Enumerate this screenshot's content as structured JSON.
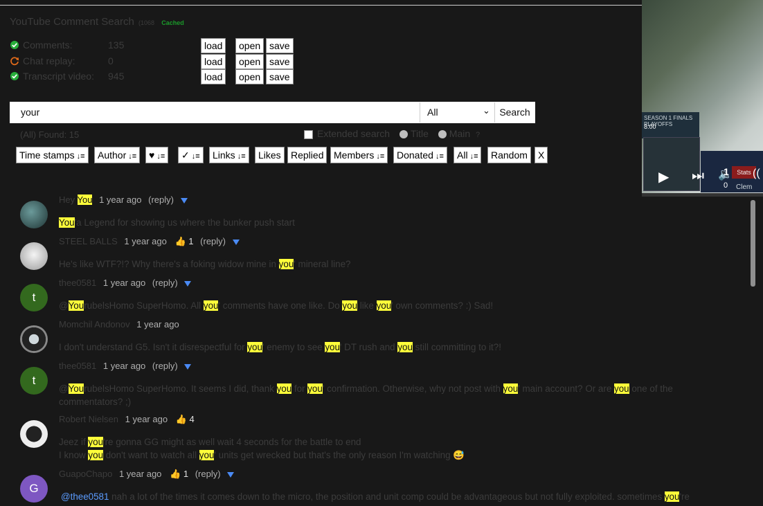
{
  "header": {
    "title": "YouTube Comment Search",
    "version": "(1068",
    "cached": "Cached"
  },
  "sources": [
    {
      "label": "Comments:",
      "count": "135",
      "status": "done"
    },
    {
      "label": "Chat replay:",
      "count": "0",
      "status": "pending"
    },
    {
      "label": "Transcript video:",
      "count": "945",
      "status": "done"
    }
  ],
  "buttons": {
    "load": "load",
    "open": "open",
    "save": "save"
  },
  "search": {
    "query": "your",
    "scope": "All",
    "button": "Search"
  },
  "found_label": "(All) Found: 15",
  "options": {
    "extended": "Extended search",
    "title": "Title",
    "main": "Main",
    "help": "?"
  },
  "sort_buttons": [
    "Time stamps",
    "Author",
    "♥",
    "✓",
    "Links",
    "Likes",
    "Replied",
    "Members",
    "Donated",
    "All",
    "Random",
    "X"
  ],
  "video": {
    "season": "SEASON 1 FINALS PLAYOFFS",
    "time": "8:00",
    "stats": "Stats",
    "player": "Clem",
    "big_number": "1",
    "small_number": "0"
  },
  "colors": {
    "highlight": "#ffff3a",
    "reply_toggle": "#4a8af4",
    "mention": "#5b9cff",
    "ok_green": "#27ae3a",
    "pending_orange": "#e06a1a"
  },
  "comments": [
    {
      "author": "Hey ",
      "author_hl": "You",
      "date": "1 year ago",
      "reply": "(reply)",
      "likes": "",
      "avatar": {
        "type": "image",
        "color": "#3a5a5a"
      },
      "lines": [
        [
          "",
          "You",
          "'a Legend for showing us where the bunker push start"
        ]
      ]
    },
    {
      "author": "STEEL BALLS",
      "date": "1 year ago",
      "likes": "1",
      "reply": "(reply)",
      "avatar": {
        "type": "image",
        "color": "#d9d9d9"
      },
      "lines": [
        [
          "He's like WTF?!? Why there's a foking widow mine in ",
          "you",
          "' mineral line?"
        ]
      ]
    },
    {
      "author": "thee0581",
      "date": "1 year ago",
      "reply": "(reply)",
      "likes": "",
      "avatar": {
        "type": "letter",
        "letter": "t",
        "color": "#33691e"
      },
      "lines": [
        [
          "@",
          "You",
          "rubelsHomo SuperHomo. All ",
          "you",
          "' comments have one like. Do ",
          "you",
          " like ",
          "you",
          "' own comments? :) Sad!"
        ]
      ]
    },
    {
      "author": "Momchil Andonov",
      "date": "1 year ago",
      "reply": "",
      "likes": "",
      "avatar": {
        "type": "image",
        "color": "#444"
      },
      "lines": [
        [
          "I don't understand G5. Isn't it disrespectful for ",
          "you",
          "' enemy to see ",
          "you",
          "' DT rush and ",
          "you",
          " still committing to it?!"
        ]
      ]
    },
    {
      "author": "thee0581",
      "date": "1 year ago",
      "reply": "(reply)",
      "likes": "",
      "avatar": {
        "type": "letter",
        "letter": "t",
        "color": "#33691e"
      },
      "lines": [
        [
          "@",
          "You",
          "rubelsHomo SuperHomo. It seems I did, thank ",
          "you",
          " for ",
          "you",
          "' confirmation. Otherwise, why not post with ",
          "you",
          "' main account? Or are ",
          "you",
          " one of the"
        ],
        [
          "commentators? ;)"
        ]
      ]
    },
    {
      "author": "Robert Nielsen",
      "date": "1 year ago",
      "likes": "4",
      "reply": "",
      "avatar": {
        "type": "image",
        "color": "#eeeeee"
      },
      "lines": [
        [
          "Jeez if ",
          "you",
          "'re gonna GG might as well wait 4 seconds for the battle to end"
        ],
        [
          "I know ",
          "you",
          " don't want to watch all ",
          "you",
          "' units get wrecked but that's the only reason I'm watching 😅"
        ]
      ]
    },
    {
      "author": "GuapoChapo",
      "date": "1 year ago",
      "likes": "1",
      "reply": "(reply)",
      "avatar": {
        "type": "letter",
        "letter": "G",
        "color": "#7e57c2"
      },
      "mention": "@thee0581",
      "lines": [
        [
          " nah a lot of the times it comes down to the micro, the position and unit comp could be advantageous but not fully exploited. sometimes ",
          "you",
          "'re"
        ]
      ]
    }
  ]
}
